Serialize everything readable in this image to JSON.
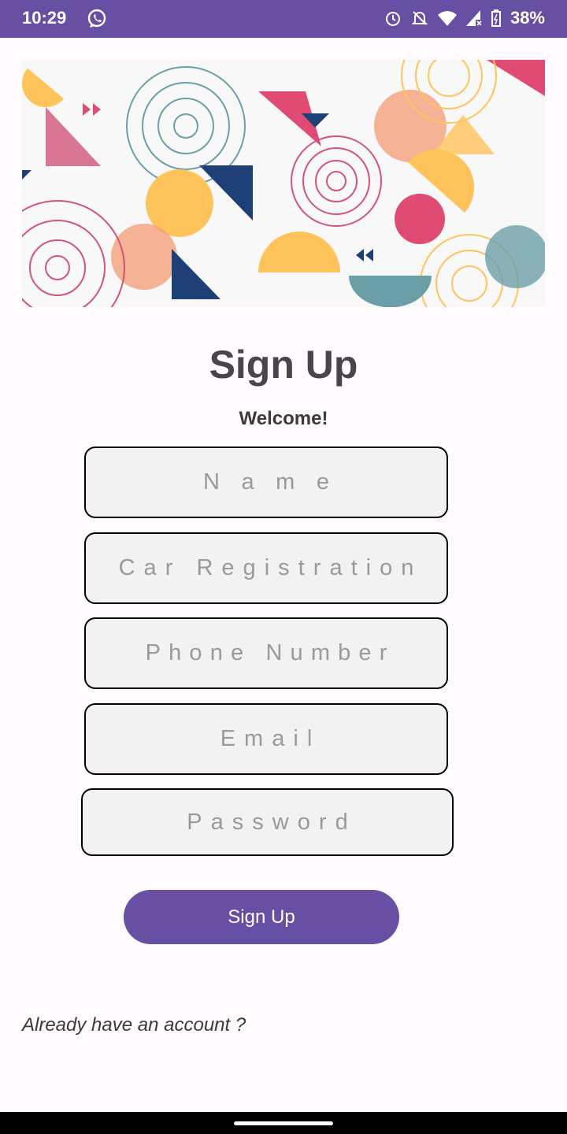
{
  "status_bar": {
    "time": "10:29",
    "battery": "38%",
    "icons": [
      "whatsapp-icon",
      "alarm-icon",
      "bell-off-icon",
      "wifi-icon",
      "signal-icon",
      "battery-charging-icon"
    ],
    "color": "#6750a4"
  },
  "header": {
    "title": "Sign Up",
    "subtitle": "Welcome!"
  },
  "form": {
    "name_placeholder": "Name",
    "car_placeholder": "Car Registration",
    "phone_placeholder": "Phone Number",
    "email_placeholder": "Email",
    "password_placeholder": "Password"
  },
  "actions": {
    "signup_label": "Sign Up",
    "login_link": "Already have an account ?"
  }
}
